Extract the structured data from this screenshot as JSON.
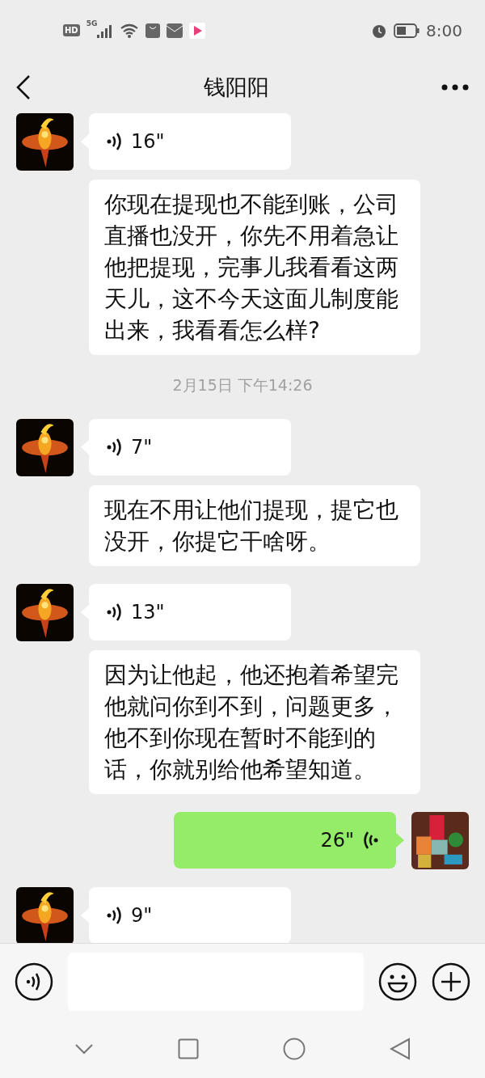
{
  "status_bar": {
    "hd": "HD",
    "network": "5G",
    "time": "8:00"
  },
  "header": {
    "title": "钱阳阳"
  },
  "messages": [
    {
      "kind": "voice",
      "outgoing": false,
      "duration": "16\""
    },
    {
      "kind": "text",
      "outgoing": false,
      "text": "你现在提现也不能到账，公司直播也没开，你先不用着急让他把提现，完事儿我看看这两天儿，这不今天这面儿制度能出来，我看看怎么样?"
    },
    {
      "kind": "time",
      "text": "2月15日 下午14:26"
    },
    {
      "kind": "voice",
      "outgoing": false,
      "duration": "7\""
    },
    {
      "kind": "text",
      "outgoing": false,
      "text": "现在不用让他们提现，提它也没开，你提它干啥呀。"
    },
    {
      "kind": "voice",
      "outgoing": false,
      "duration": "13\""
    },
    {
      "kind": "text",
      "outgoing": false,
      "text": "因为让他起，他还抱着希望完他就问你到不到，问题更多，他不到你现在暂时不能到的话，你就别给他希望知道。"
    },
    {
      "kind": "voice",
      "outgoing": true,
      "duration": "26\""
    },
    {
      "kind": "voice",
      "outgoing": false,
      "duration": "9\""
    }
  ]
}
